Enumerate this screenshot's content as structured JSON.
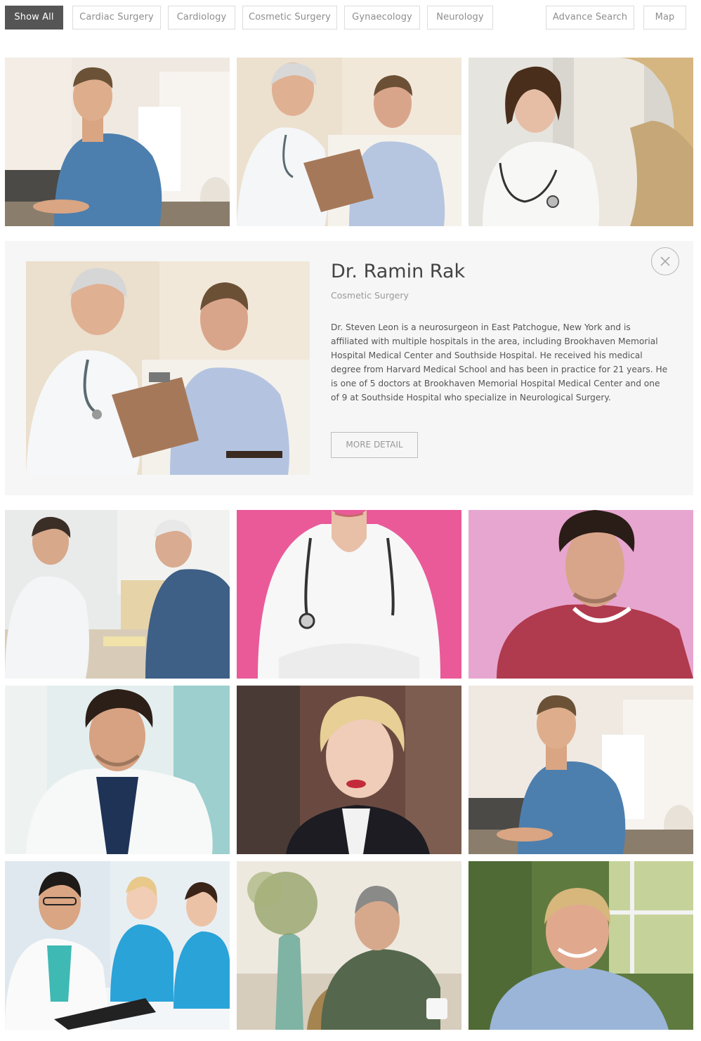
{
  "filters": {
    "items": [
      {
        "label": "Show All",
        "active": true
      },
      {
        "label": "Cardiac Surgery",
        "active": false
      },
      {
        "label": "Cardiology",
        "active": false
      },
      {
        "label": "Cosmetic Surgery",
        "active": false
      },
      {
        "label": "Gynaecology",
        "active": false
      },
      {
        "label": "Neurology",
        "active": false
      }
    ],
    "advance_search_label": "Advance Search",
    "map_label": "Map"
  },
  "detail": {
    "name": "Dr. Ramin Rak",
    "specialty": "Cosmetic Surgery",
    "bio": "Dr. Steven Leon is a neurosurgeon in East Patchogue, New York and is affiliated with multiple hospitals in the area, including Brookhaven Memorial Hospital Medical Center and Southside Hospital. He received his medical degree from Harvard Medical School and has been in practice for 21 years. He is one of 5 doctors at Brookhaven Memorial Hospital Medical Center and one of 9 at Southside Hospital who specialize in Neurological Surgery.",
    "more_label": "MORE DETAIL"
  },
  "colors": {
    "active_filter": "#555555",
    "panel_bg": "#f6f6f6",
    "border": "#dcdcdc"
  }
}
